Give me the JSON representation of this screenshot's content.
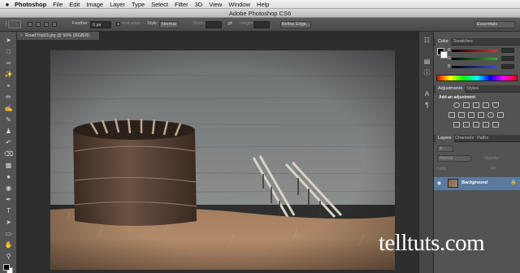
{
  "menubar": {
    "app": "Photoshop",
    "items": [
      "File",
      "Edit",
      "Image",
      "Layer",
      "Type",
      "Select",
      "Filter",
      "3D",
      "View",
      "Window",
      "Help"
    ]
  },
  "window": {
    "title": "Adobe Photoshop CS6"
  },
  "options": {
    "feather_label": "Feather:",
    "feather_value": "0 px",
    "antialias_label": "Anti-alias",
    "style_label": "Style:",
    "style_value": "Normal",
    "width_label": "Width:",
    "height_label": "Height:",
    "refine_label": "Refine Edge...",
    "workspace": "Essentials"
  },
  "document": {
    "tab_label": "RoadTrip03.jpg @ 50% (RGB/8)"
  },
  "panels": {
    "color_tab": "Color",
    "swatches_tab": "Swatches",
    "sliders": [
      {
        "label": "R",
        "value": "",
        "color": "#e03030"
      },
      {
        "label": "G",
        "value": "",
        "color": "#30b030"
      },
      {
        "label": "B",
        "value": "",
        "color": "#3050e0"
      }
    ],
    "adjustments_tab": "Adjustments",
    "styles_tab": "Styles",
    "add_adjustment": "Add an adjustment",
    "layers_tab": "Layers",
    "channels_tab": "Channels",
    "paths_tab": "Paths",
    "blend_mode": "Normal",
    "opacity_label": "Opacity:",
    "lock_label": "Lock:",
    "fill_label": "Fill:",
    "layer_name": "Background"
  },
  "watermark": "telltuts.com",
  "colors": {
    "selected_layer": "#5b7a9f",
    "panel_bg": "#535353"
  }
}
